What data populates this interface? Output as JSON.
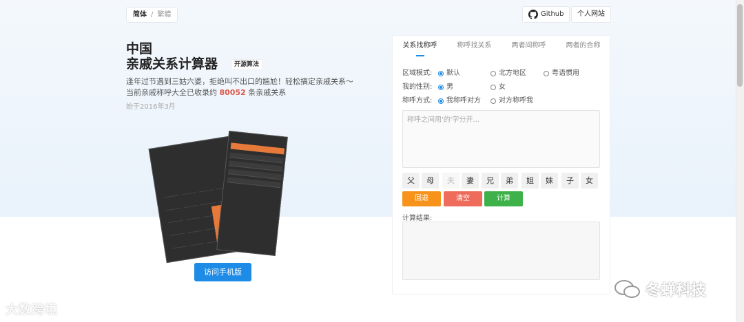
{
  "lang": {
    "simplified": "简体",
    "separator": "/",
    "traditional": "繁體"
  },
  "top_links": {
    "github": "Github",
    "personal_site": "个人网站"
  },
  "hero": {
    "title_line1": "中国",
    "title_line2": "亲戚关系计算器",
    "oss_tag": "开源算法",
    "desc_line1": "逢年过节遇到三姑六婆，拒绝叫不出口的尴尬！轻松搞定亲戚关系～",
    "desc_prefix": "当前亲戚称呼大全已收录约",
    "count": "80052",
    "desc_suffix": "条亲戚关系",
    "since": "始于2016年3月",
    "visit_mobile": "访问手机版"
  },
  "panel": {
    "tabs": [
      "关系找称呼",
      "称呼找关系",
      "两者间称呼",
      "两者的合称"
    ],
    "active_tab": 0,
    "region": {
      "label": "区域模式:",
      "options": [
        "默认",
        "北方地区",
        "粤语惯用"
      ],
      "selected": 0
    },
    "gender": {
      "label": "我的性别:",
      "options": [
        "男",
        "女"
      ],
      "selected": 0
    },
    "address": {
      "label": "称呼方式:",
      "options": [
        "我称呼对方",
        "对方称呼我"
      ],
      "selected": 0
    },
    "input_placeholder": "称呼之间用'的'字分开...",
    "keys": [
      "父",
      "母",
      "夫",
      "妻",
      "兄",
      "弟",
      "姐",
      "妹",
      "子",
      "女"
    ],
    "disabled_keys": [
      "夫"
    ],
    "actions": {
      "back": "回退",
      "clear": "清空",
      "calc": "计算"
    },
    "action_colors": {
      "back": "#f7931a",
      "clear": "#ef6b5b",
      "calc": "#3fb14a"
    },
    "result_label": "计算结果:"
  },
  "watermarks": {
    "left": "大数跨境",
    "right": "冬蝉科技"
  },
  "colors": {
    "accent": "#1e8ce6",
    "highlight": "#e0584e"
  }
}
